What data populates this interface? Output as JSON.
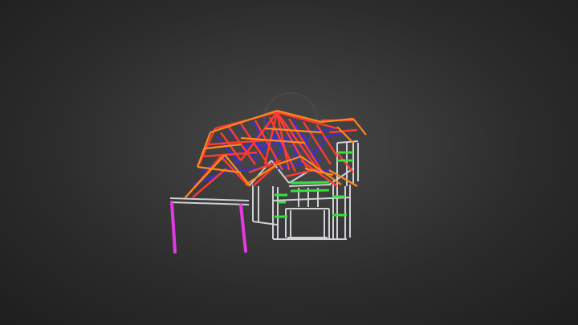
{
  "viewer": {
    "background_color": "#3a3a3a",
    "model_colors": {
      "rafters": "#ff3b2f",
      "battens": "#ff8a1e",
      "webbing": "#3b2fd6",
      "wall_frame": "#cfd2d6",
      "noggings": "#35e33b",
      "posts": "#e23be0"
    }
  }
}
